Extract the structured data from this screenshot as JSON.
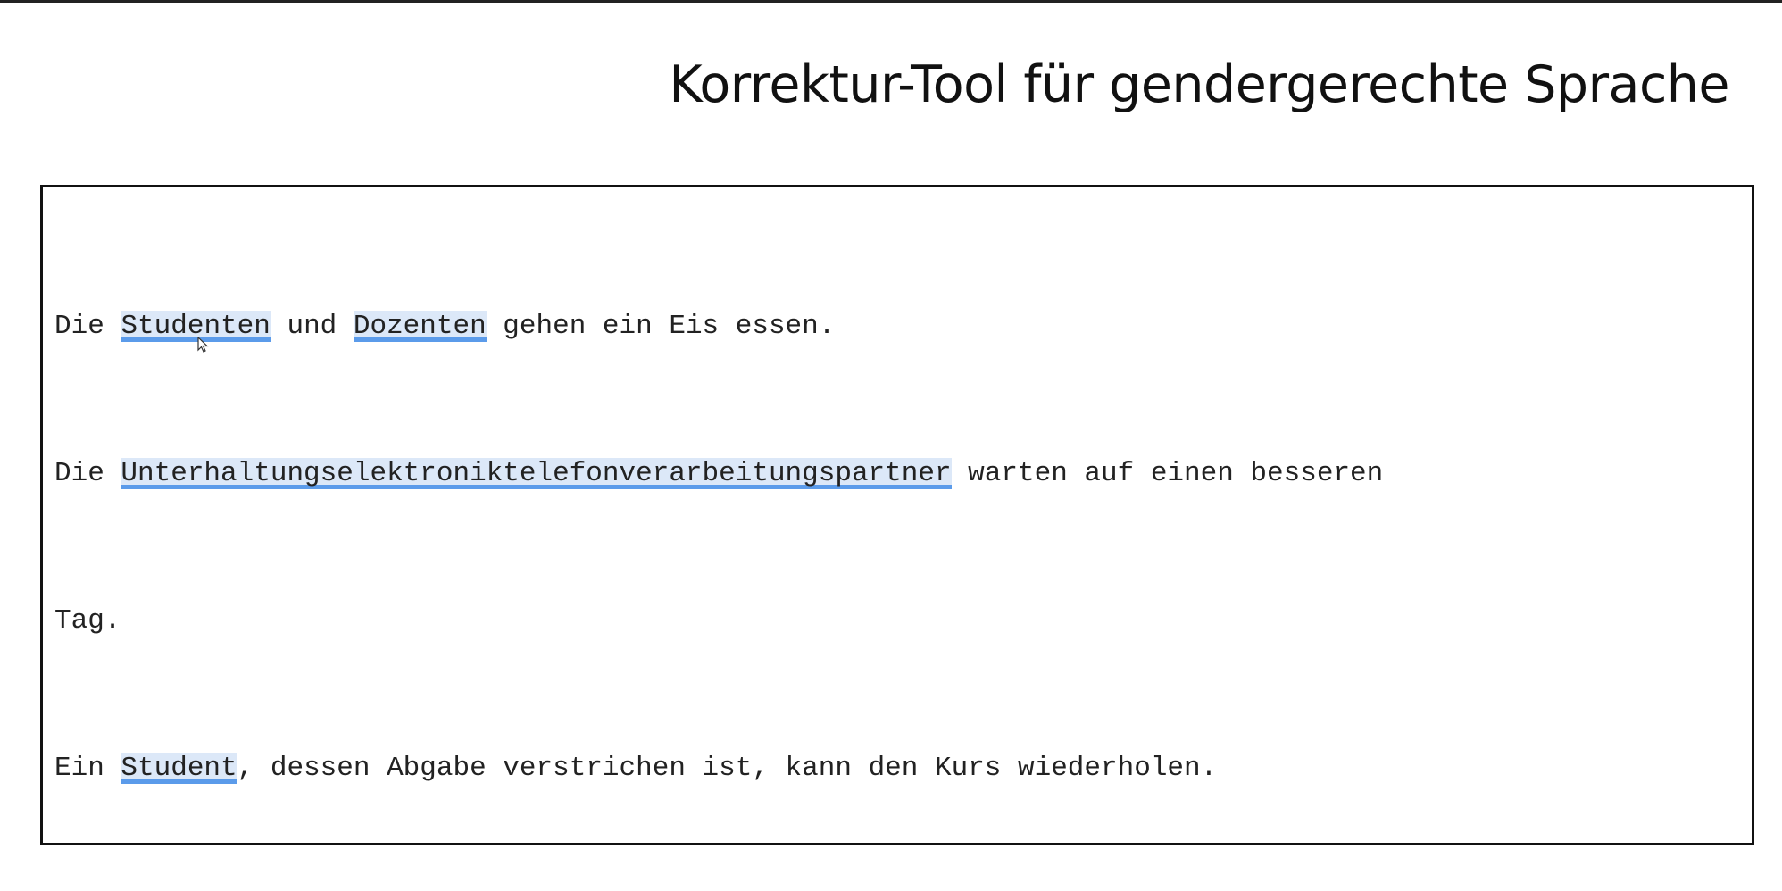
{
  "app": {
    "title": "Korrektur-Tool für gendergerechte Sprache"
  },
  "editor": {
    "lines": [
      {
        "segments": [
          {
            "text": "Die ",
            "flagged": false
          },
          {
            "text": "Stude",
            "flagged": true
          },
          {
            "text": "nten",
            "flagged": true
          },
          {
            "text": " und ",
            "flagged": false
          },
          {
            "text": "Dozenten",
            "flagged": true
          },
          {
            "text": " gehen ein Eis essen.",
            "flagged": false
          }
        ]
      },
      {
        "segments": [
          {
            "text": "Die ",
            "flagged": false
          },
          {
            "text": "Unterhaltungselektroniktelefonverarbeitungspartner",
            "flagged": true
          },
          {
            "text": " warten auf einen besseren",
            "flagged": false
          }
        ]
      },
      {
        "segments": [
          {
            "text": "Tag.",
            "flagged": false
          }
        ]
      },
      {
        "segments": [
          {
            "text": "Ein ",
            "flagged": false
          },
          {
            "text": "Student",
            "flagged": true
          },
          {
            "text": ", dessen Abgabe verstrichen ist, kann den Kurs wiederholen.",
            "flagged": false
          }
        ]
      }
    ]
  },
  "colors": {
    "flag_background": "#dce8f8",
    "flag_underline": "#5b9bea"
  },
  "icons": {
    "cursor": "mouse-pointer-icon"
  }
}
